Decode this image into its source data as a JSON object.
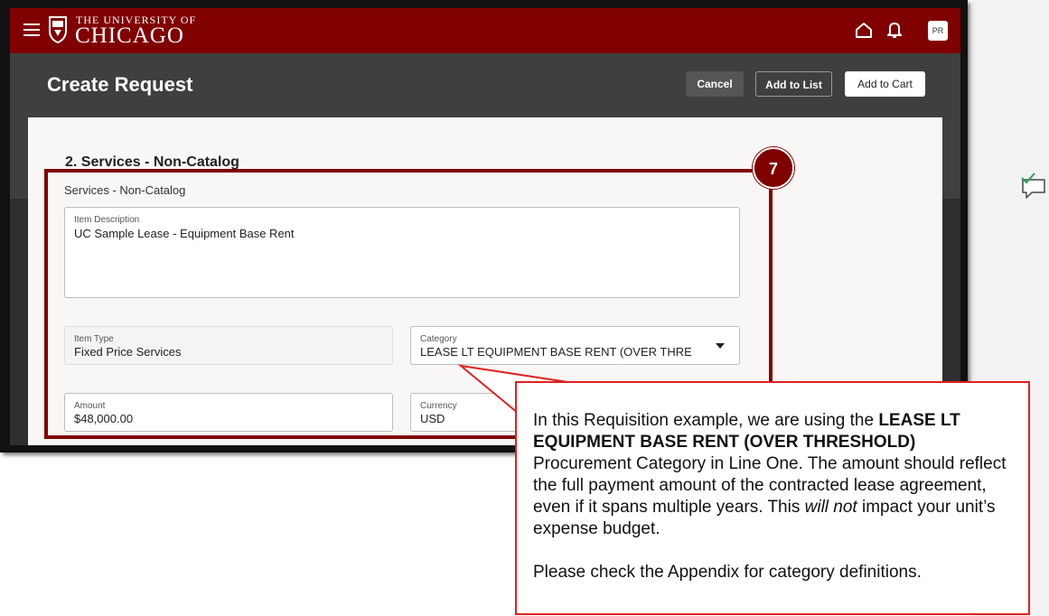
{
  "app": {
    "logo_line1": "THE UNIVERSITY OF",
    "logo_line2": "CHICAGO",
    "avatar_initials": "PR",
    "brand_color": "#800000"
  },
  "page": {
    "title": "Create Request",
    "buttons": {
      "cancel": "Cancel",
      "add_to_list": "Add to List",
      "add_to_cart": "Add to Cart"
    }
  },
  "form": {
    "section_title": "2. Services - Non-Catalog",
    "subsection_label": "Services - Non-Catalog",
    "item_description": {
      "label": "Item Description",
      "value": "UC Sample Lease - Equipment Base Rent"
    },
    "item_type": {
      "label": "Item Type",
      "value": "Fixed Price Services"
    },
    "category": {
      "label": "Category",
      "value": "LEASE LT EQUIPMENT BASE RENT (OVER THRESHOLD)"
    },
    "amount": {
      "label": "Amount",
      "value": "$48,000.00"
    },
    "currency": {
      "label": "Currency",
      "value": "USD"
    }
  },
  "annotation": {
    "step_number": "7",
    "callout": {
      "intro": "In this Requisition example, we are using the ",
      "bold": "LEASE LT EQUIPMENT BASE RENT (OVER THRESHOLD)",
      "middle": " Procurement Category in Line One. The amount should reflect the full payment amount of the contracted lease agreement, even if it spans multiple years. This ",
      "italic": "will not",
      "end": " impact your unit’s expense budget.",
      "second_paragraph": "Please check the Appendix for category definitions."
    }
  }
}
